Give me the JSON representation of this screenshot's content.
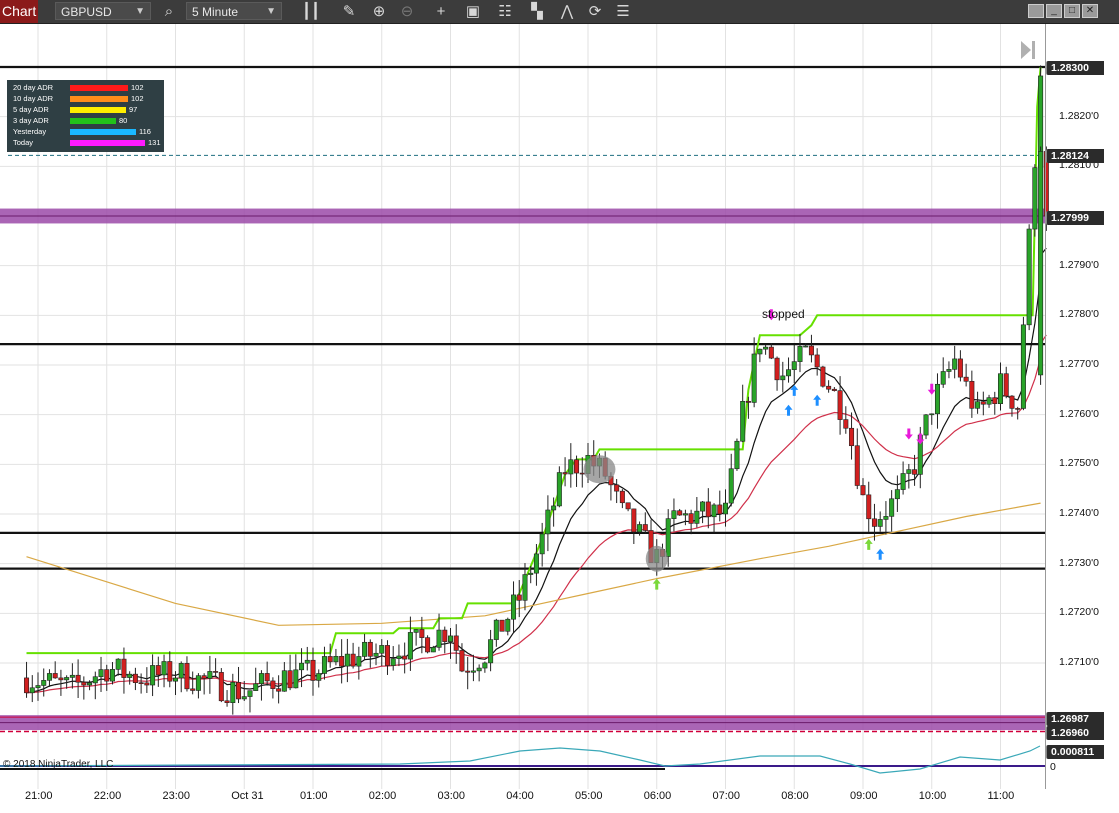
{
  "toolbar": {
    "chart_tab": "Chart",
    "instrument": "GBPUSD",
    "timeframe": "5 Minute",
    "icons": [
      "search-icon",
      "bar-style-icon",
      "pencil-icon",
      "zoom-in-icon",
      "zoom-out-icon",
      "crosshair-icon",
      "data-box-icon",
      "strategies-icon",
      "indicators-icon",
      "drawing-tools-icon",
      "refresh-icon",
      "properties-icon"
    ],
    "window_buttons": [
      "restore-icon",
      "minimize-icon",
      "maximize-icon",
      "close-icon"
    ]
  },
  "price_labels": {
    "top_line": "1.28300",
    "dashed_cyan": "1.28124",
    "last_price": "1.27999",
    "bottom_line1": "1.26987",
    "bottom_line2": "1.26960",
    "osc_value": "0.000811",
    "osc_zero": "0"
  },
  "y_ticks": [
    "1.2820'0",
    "1.2810'0",
    "1.2790'0",
    "1.2780'0",
    "1.2770'0",
    "1.2760'0",
    "1.2750'0",
    "1.2740'0",
    "1.2730'0",
    "1.2720'0",
    "1.2710'0"
  ],
  "x_ticks": [
    "21:00",
    "22:00",
    "23:00",
    "Oct 31",
    "01:00",
    "02:00",
    "03:00",
    "04:00",
    "05:00",
    "06:00",
    "07:00",
    "08:00",
    "09:00",
    "10:00",
    "11:00"
  ],
  "adr_panel": [
    {
      "label": "20 day ADR",
      "value": "102",
      "color": "#ff1a1a"
    },
    {
      "label": "10 day ADR",
      "value": "102",
      "color": "#ff8c1a"
    },
    {
      "label": "5 day ADR",
      "value": "97",
      "color": "#ffee00"
    },
    {
      "label": "3 day ADR",
      "value": "80",
      "color": "#22c21a"
    },
    {
      "label": "Yesterday",
      "value": "116",
      "color": "#1ab8ff"
    },
    {
      "label": "Today",
      "value": "131",
      "color": "#ff1aff"
    }
  ],
  "annotation": "stopped",
  "copyright": "© 2018 NinjaTrader, LLC",
  "chart_data": {
    "type": "candlestick",
    "instrument": "GBPUSD",
    "interval": "5 Minute",
    "ylim": [
      1.2688,
      1.2834
    ],
    "horizontal_levels": [
      1.283,
      1.27742,
      1.27362,
      1.2729
    ],
    "zones": [
      {
        "low": 1.27985,
        "high": 1.28015,
        "color": "#9b4aa8"
      },
      {
        "low": 1.26965,
        "high": 1.26995,
        "color": "#9b4aa8"
      }
    ],
    "close_path": [
      [
        "20:50",
        1.2707
      ],
      [
        "21:30",
        1.2705
      ],
      [
        "22:00",
        1.2709
      ],
      [
        "22:30",
        1.2707
      ],
      [
        "23:00",
        1.2708
      ],
      [
        "23:30",
        1.2706
      ],
      [
        "00:00",
        1.2704
      ],
      [
        "00:30",
        1.2707
      ],
      [
        "01:00",
        1.2708
      ],
      [
        "01:30",
        1.2711
      ],
      [
        "02:00",
        1.2712
      ],
      [
        "02:30",
        1.2714
      ],
      [
        "03:00",
        1.2717
      ],
      [
        "03:10",
        1.2709
      ],
      [
        "03:30",
        1.2712
      ],
      [
        "04:00",
        1.2723
      ],
      [
        "04:20",
        1.2735
      ],
      [
        "04:40",
        1.2749
      ],
      [
        "05:00",
        1.2751
      ],
      [
        "05:15",
        1.2748
      ],
      [
        "05:30",
        1.274
      ],
      [
        "05:50",
        1.2734
      ],
      [
        "06:00",
        1.2731
      ],
      [
        "06:15",
        1.2739
      ],
      [
        "06:40",
        1.274
      ],
      [
        "07:00",
        1.274
      ],
      [
        "07:15",
        1.276
      ],
      [
        "07:30",
        1.2775
      ],
      [
        "07:50",
        1.2768
      ],
      [
        "08:10",
        1.2772
      ],
      [
        "08:25",
        1.2768
      ],
      [
        "08:45",
        1.276
      ],
      [
        "09:00",
        1.2743
      ],
      [
        "09:10",
        1.2739
      ],
      [
        "09:30",
        1.2743
      ],
      [
        "09:45",
        1.275
      ],
      [
        "10:00",
        1.2762
      ],
      [
        "10:20",
        1.2771
      ],
      [
        "10:40",
        1.276
      ],
      [
        "11:00",
        1.2766
      ],
      [
        "11:15",
        1.2762
      ],
      [
        "11:30",
        1.2812
      ],
      [
        "11:35",
        1.283
      ],
      [
        "11:40",
        1.28
      ]
    ],
    "series": [
      {
        "name": "stop",
        "color": "#66e000"
      },
      {
        "name": "fast_ma",
        "color": "#111111"
      },
      {
        "name": "mid_ma",
        "color": "#d0304a"
      },
      {
        "name": "slow_ma",
        "color": "#d9a845"
      }
    ]
  }
}
